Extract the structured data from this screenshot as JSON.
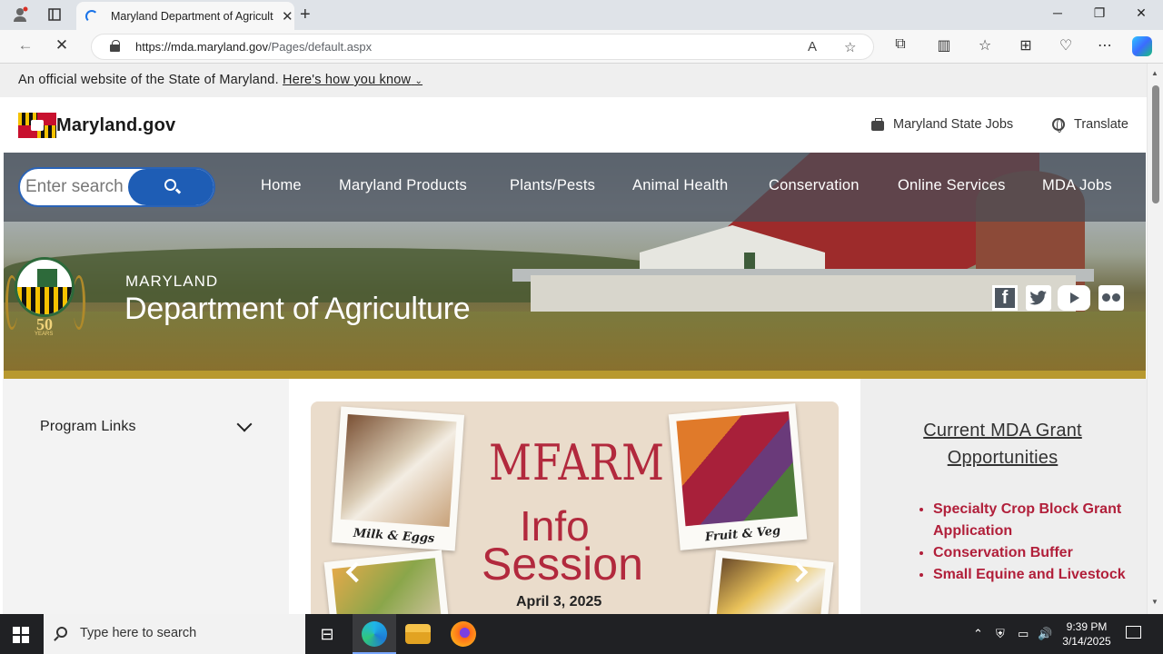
{
  "browser": {
    "tab_title": "Maryland Department of Agricult",
    "url_host": "https://mda.maryland.gov",
    "url_path": "/Pages/default.aspx"
  },
  "banner": {
    "official_text": "An official website of the State of Maryland.",
    "how_link": "Here's how you know"
  },
  "header": {
    "brand": "Maryland.gov",
    "jobs_link": "Maryland State Jobs",
    "translate_link": "Translate"
  },
  "search": {
    "placeholder": "Enter search"
  },
  "nav": {
    "items": [
      "Home",
      "Maryland Products",
      "Plants/Pests",
      "Animal Health",
      "Conservation",
      "Online Services",
      "MDA Jobs"
    ]
  },
  "hero": {
    "seal_number": "50",
    "seal_years": "YEARS",
    "dept_small": "MARYLAND",
    "dept_big": "Department of Agriculture"
  },
  "sidebar": {
    "program_links": "Program Links"
  },
  "promo": {
    "caption_milk": "Milk & Eggs",
    "caption_fruit": "Fruit & Veg",
    "title": "MFARM",
    "line2": "Info",
    "line3": "Session",
    "date": "April 3, 2025"
  },
  "grants": {
    "title": "Current MDA Grant Opportunities",
    "items": [
      "Specialty Crop Block Grant Application",
      "Conservation Buffer",
      "Small Equine and Livestock"
    ]
  },
  "taskbar": {
    "search_text": "Type here to search",
    "time": "9:39 PM",
    "date": "3/14/2025"
  },
  "colors": {
    "accent_blue": "#1e5db5",
    "link_red": "#b11f3a",
    "promo_red": "#b2293d"
  }
}
